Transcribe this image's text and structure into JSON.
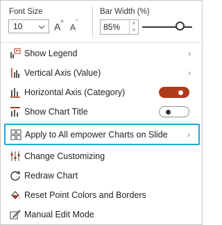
{
  "font_size": {
    "label": "Font Size",
    "value": "10",
    "increase_label": "A",
    "decrease_label": "A"
  },
  "bar_width": {
    "label": "Bar Width (%)",
    "value": "85%",
    "slider_level": 0.75
  },
  "menu": {
    "show_legend": "Show Legend",
    "vertical_axis": "Vertical Axis (Value)",
    "horizontal_axis": "Horizontal Axis (Category)",
    "horizontal_axis_on": true,
    "show_chart_title": "Show Chart Title",
    "show_chart_title_on": false,
    "apply_all": "Apply to All empower Charts on Slide",
    "change_customizing": "Change Customizing",
    "redraw": "Redraw Chart",
    "reset_colors": "Reset Point Colors and Borders",
    "manual_edit": "Manual Edit Mode"
  },
  "colors": {
    "toggle_on": "#b03a1e",
    "highlight": "#1ea7d8"
  }
}
